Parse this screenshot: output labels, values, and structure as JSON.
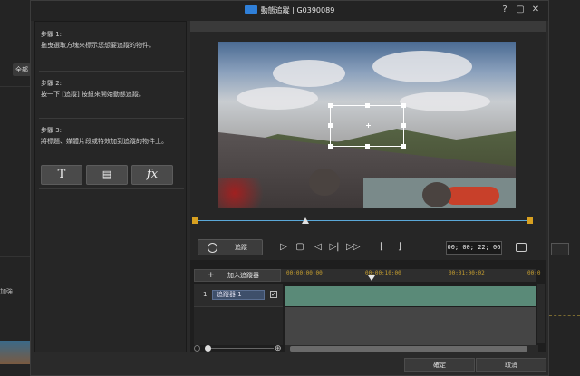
{
  "window": {
    "title": "動態追蹤 | G0390089",
    "help": "?",
    "restore": "▢",
    "close": "✕"
  },
  "background": {
    "left_tab": "全部",
    "left_text": "加強"
  },
  "steps": [
    {
      "title": "步驟 1:",
      "text": "拖曳選取方塊來標示您想要追蹤的物件。"
    },
    {
      "title": "步驟 2:",
      "text": "按一下 [追蹤] 按鈕來開始動態追蹤。"
    },
    {
      "title": "步驟 3:",
      "text": "將標題、媒體片段或特效加到追蹤的物件上。"
    }
  ],
  "tools": [
    {
      "label": "T",
      "icon": "text-icon"
    },
    {
      "label": "▤",
      "icon": "media-icon"
    },
    {
      "label": "fx",
      "icon": "effect-icon"
    }
  ],
  "controls": {
    "track_label": "追蹤",
    "play": "▷",
    "stop": "▢",
    "prev": "◁",
    "next_frame": "▷|",
    "fast_forward": "▷▷",
    "timecode": "00; 00; 22; 06"
  },
  "timeline": {
    "add_tracker": "加入追蹤器",
    "ruler": [
      "00;00;00;00",
      "00;00;10;00",
      "00;01;00;02",
      "00;0"
    ],
    "track_number": "1.",
    "track_name": "追蹤器 1",
    "checked": "✓"
  },
  "footer": {
    "ok": "確定",
    "cancel": "取消"
  }
}
